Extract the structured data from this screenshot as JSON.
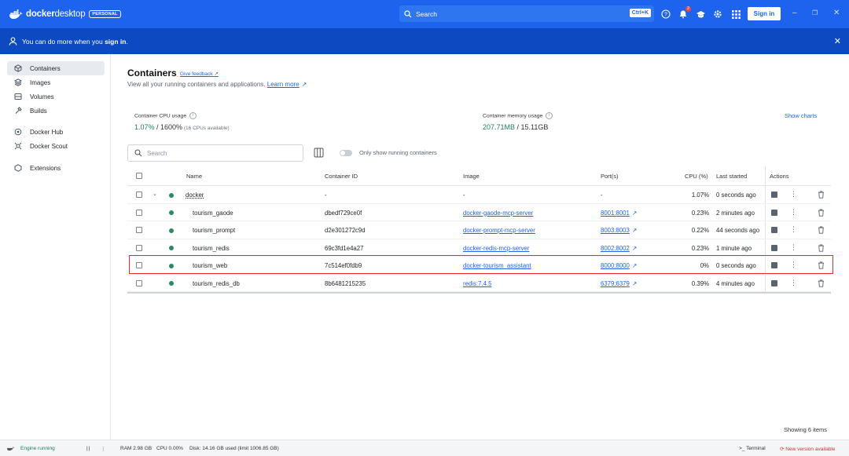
{
  "app": {
    "brand_bold": "docker",
    "brand_light": "desktop",
    "edition_badge": "PERSONAL",
    "search_placeholder": "Search",
    "search_shortcut": "Ctrl+K",
    "notification_count": "2",
    "sign_in_label": "Sign in",
    "accent_color": "#1d63ed"
  },
  "banner": {
    "text_prefix": "You can do more when you ",
    "text_bold": "sign in",
    "text_suffix": "."
  },
  "sidebar": {
    "items": [
      {
        "label": "Containers",
        "icon": "container-icon",
        "active": true
      },
      {
        "label": "Images",
        "icon": "images-icon"
      },
      {
        "label": "Volumes",
        "icon": "volumes-icon"
      },
      {
        "label": "Builds",
        "icon": "builds-icon"
      },
      {
        "label": "Docker Hub",
        "icon": "docker-hub-icon"
      },
      {
        "label": "Docker Scout",
        "icon": "docker-scout-icon"
      },
      {
        "label": "Extensions",
        "icon": "extensions-icon"
      }
    ]
  },
  "page": {
    "title": "Containers",
    "feedback_link": "Give feedback",
    "subtitle": "View all your running containers and applications.",
    "learn_more": "Learn more",
    "cpu_label": "Container CPU usage",
    "cpu_value": "1.07%",
    "cpu_total": " / 1600%",
    "cpu_note": " (16 CPUs available)",
    "memory_label": "Container memory usage",
    "memory_value": "207.71MB",
    "memory_total": " / 15.11GB",
    "show_charts": "Show charts",
    "search_placeholder": "Search",
    "toggle_label": "Only show running containers",
    "showing_items": "Showing 6 items"
  },
  "table": {
    "headers": {
      "name": "Name",
      "container_id": "Container ID",
      "image": "Image",
      "ports": "Port(s)",
      "cpu": "CPU (%)",
      "last_started": "Last started",
      "actions": "Actions"
    },
    "rows": [
      {
        "name": "docker",
        "container_id": "-",
        "image": "-",
        "ports": "-",
        "cpu": "1.07%",
        "last_started": "0 seconds ago",
        "group": true
      },
      {
        "name": "tourism_gaode",
        "container_id": "dbedf729ce0f",
        "image": "docker-gaode-mcp-server",
        "ports": "8001:8001",
        "cpu": "0.23%",
        "last_started": "2 minutes ago"
      },
      {
        "name": "tourism_prompt",
        "container_id": "d2e301272c9d",
        "image": "docker-prompt-mcp-server",
        "ports": "8003:8003",
        "cpu": "0.22%",
        "last_started": "44 seconds ago"
      },
      {
        "name": "tourism_redis",
        "container_id": "69c3fd1e4a27",
        "image": "docker-redis-mcp-server",
        "ports": "8002:8002",
        "cpu": "0.23%",
        "last_started": "1 minute ago"
      },
      {
        "name": "tourism_web",
        "container_id": "7c514ef0fdb9",
        "image": "docker-tourism_assistant",
        "ports": "8000:8000",
        "cpu": "0%",
        "last_started": "0 seconds ago"
      },
      {
        "name": "tourism_redis_db",
        "container_id": "8b6481215235",
        "image": "redis:7.4.5",
        "ports": "6379:6379",
        "cpu": "0.39%",
        "last_started": "4 minutes ago"
      }
    ]
  },
  "footer": {
    "engine_status": "Engine running",
    "ram": "RAM 2.98 GB",
    "cpu": "CPU 0.00%",
    "disk": "Disk: 14.16 GB used (limit 1006.85 GB)",
    "terminal": "Terminal",
    "update": "New version available"
  }
}
